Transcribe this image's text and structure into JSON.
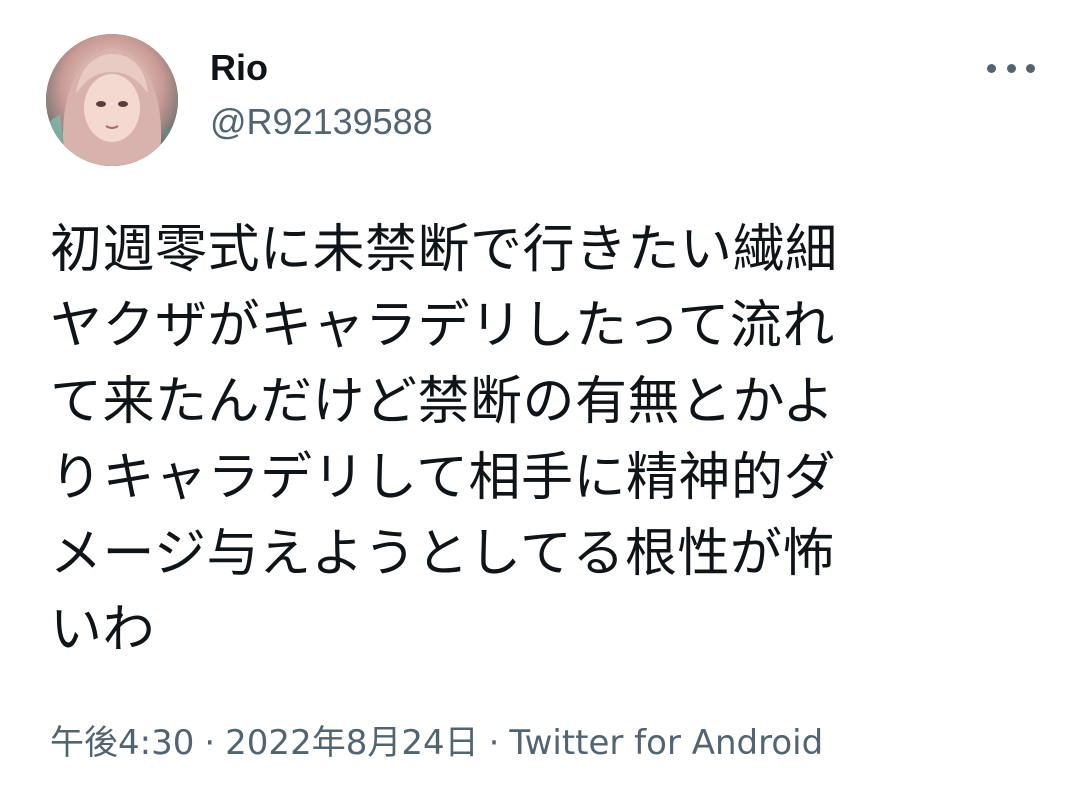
{
  "author": {
    "display_name": "Rio",
    "handle": "@R92139588"
  },
  "more_icon": "more-horizontal-icon",
  "tweet": {
    "lines": [
      "初週零式に未禁断で行きたい繊細",
      "ヤクザがキャラデリしたって流れ",
      "て来たんだけど禁断の有無とかよ",
      "りキャラデリして相手に精神的ダ",
      "メージ与えようとしてる根性が怖",
      "いわ"
    ]
  },
  "meta": {
    "time": "午後4:30",
    "separator": "·",
    "date": "2022年8月24日",
    "source": "Twitter for Android"
  },
  "colors": {
    "text_primary": "#0f1419",
    "text_secondary": "#536471",
    "background": "#ffffff"
  }
}
